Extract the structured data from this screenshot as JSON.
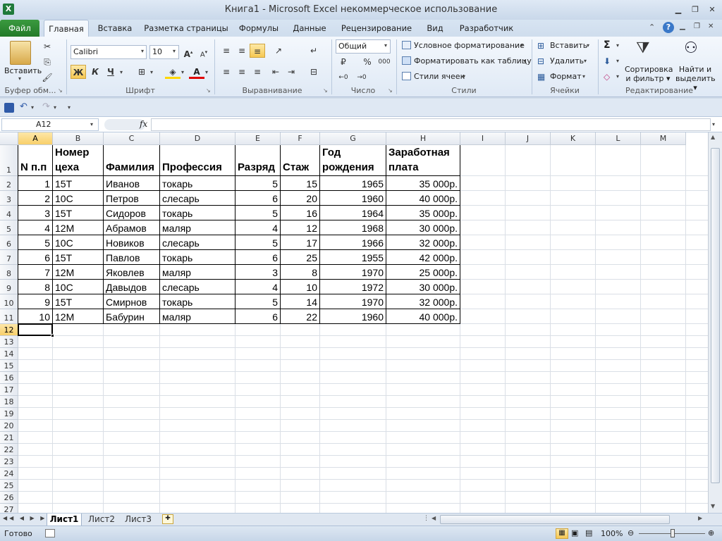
{
  "window": {
    "title": "Книга1  -  Microsoft Excel некоммерческое использование"
  },
  "tabs": [
    "Файл",
    "Главная",
    "Вставка",
    "Разметка страницы",
    "Формулы",
    "Данные",
    "Рецензирование",
    "Вид",
    "Разработчик"
  ],
  "ribbon": {
    "clipboard": {
      "paste": "Вставить",
      "label": "Буфер обм..."
    },
    "font": {
      "name": "Calibri",
      "size": "10",
      "bold": "Ж",
      "italic": "К",
      "underline": "Ч",
      "label": "Шрифт"
    },
    "alignment": {
      "label": "Выравнивание"
    },
    "number": {
      "format": "Общий",
      "percent": "%",
      "thousands": "000",
      "label": "Число"
    },
    "styles": {
      "conditional": "Условное форматирование",
      "as_table": "Форматировать как таблицу",
      "cell_styles": "Стили ячеек",
      "label": "Стили"
    },
    "cells": {
      "insert": "Вставить",
      "delete": "Удалить",
      "format": "Формат",
      "label": "Ячейки"
    },
    "editing": {
      "sum": "Σ",
      "sort1": "Сортировка",
      "sort2": "и фильтр",
      "find1": "Найти и",
      "find2": "выделить",
      "label": "Редактирование"
    }
  },
  "formula_bar": {
    "name_box": "A12",
    "fx": "fx",
    "value": ""
  },
  "columns": [
    "A",
    "B",
    "C",
    "D",
    "E",
    "F",
    "G",
    "H",
    "I",
    "J",
    "K",
    "L",
    "M"
  ],
  "rows": [
    "1",
    "2",
    "3",
    "4",
    "5",
    "6",
    "7",
    "8",
    "9",
    "10",
    "11",
    "12",
    "13",
    "14",
    "15",
    "16",
    "17",
    "18",
    "19",
    "20",
    "21",
    "22",
    "23",
    "24",
    "25",
    "26",
    "27"
  ],
  "table": {
    "headers": [
      "N п.п",
      "Номер цеха",
      "Фамилия",
      "Профессия",
      "Разряд",
      "Стаж",
      "Год рождения",
      "Заработная плата"
    ],
    "data": [
      [
        "1",
        "15Т",
        "Иванов",
        "токарь",
        "5",
        "15",
        "1965",
        "35 000р."
      ],
      [
        "2",
        "10С",
        "Петров",
        "слесарь",
        "6",
        "20",
        "1960",
        "40 000р."
      ],
      [
        "3",
        "15Т",
        "Сидоров",
        "токарь",
        "5",
        "16",
        "1964",
        "35 000р."
      ],
      [
        "4",
        "12М",
        "Абрамов",
        "маляр",
        "4",
        "12",
        "1968",
        "30 000р."
      ],
      [
        "5",
        "10С",
        "Новиков",
        "слесарь",
        "5",
        "17",
        "1966",
        "32 000р."
      ],
      [
        "6",
        "15Т",
        "Павлов",
        "токарь",
        "6",
        "25",
        "1955",
        "42 000р."
      ],
      [
        "7",
        "12М",
        "Яковлев",
        "маляр",
        "3",
        "8",
        "1970",
        "25 000р."
      ],
      [
        "8",
        "10С",
        "Давыдов",
        "слесарь",
        "4",
        "10",
        "1972",
        "30 000р."
      ],
      [
        "9",
        "15Т",
        "Смирнов",
        "токарь",
        "5",
        "14",
        "1970",
        "32 000р."
      ],
      [
        "10",
        "12М",
        "Бабурин",
        "маляр",
        "6",
        "22",
        "1960",
        "40 000р."
      ]
    ]
  },
  "sheets": [
    "Лист1",
    "Лист2",
    "Лист3"
  ],
  "status": {
    "ready": "Готово",
    "zoom": "100%"
  }
}
